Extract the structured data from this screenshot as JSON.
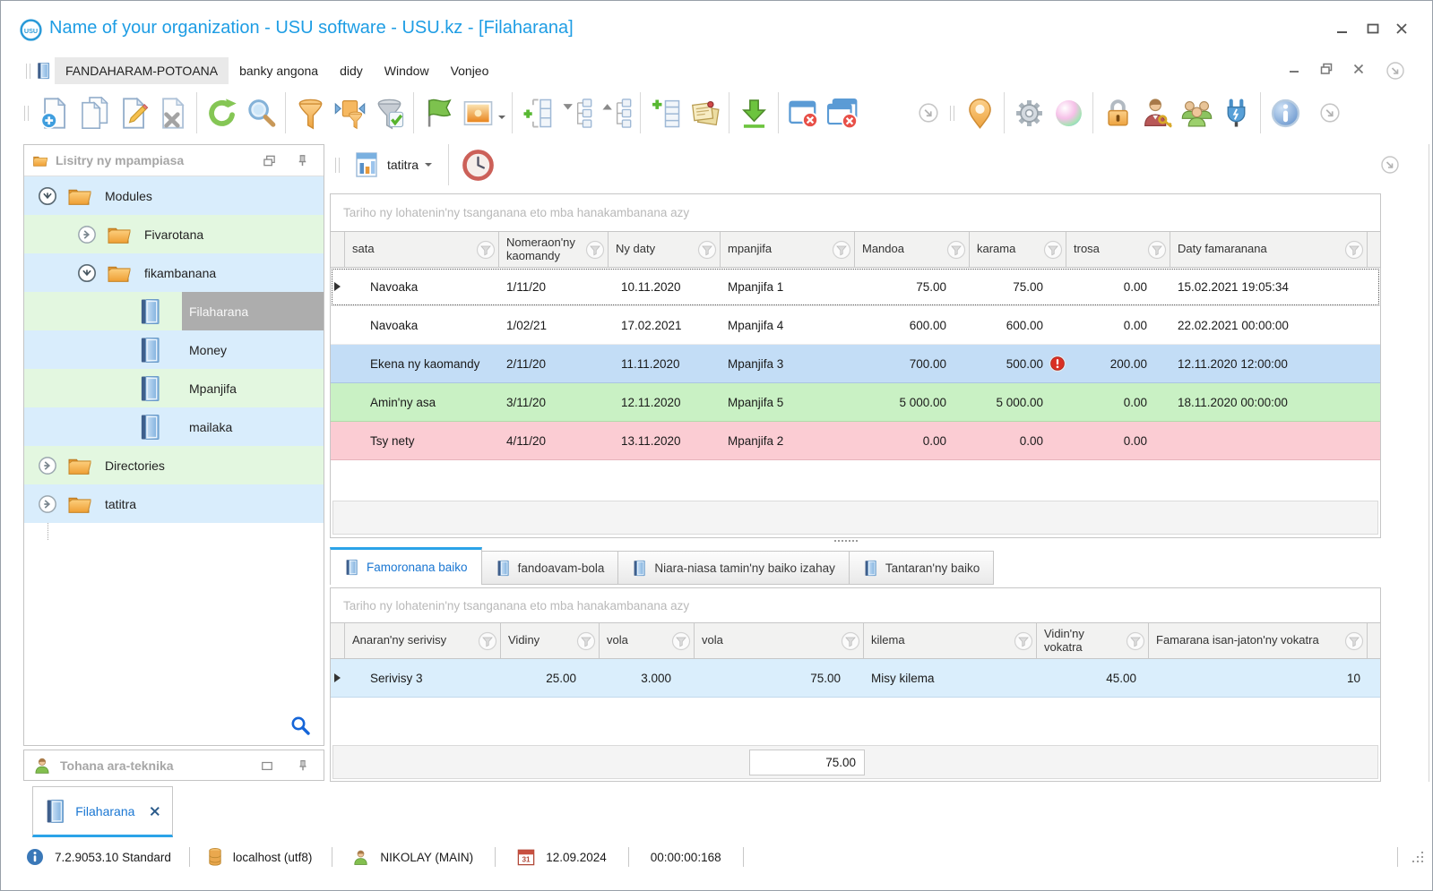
{
  "window": {
    "title": "Name of your organization - USU software - USU.kz - [Filaharana]",
    "logo": "USU"
  },
  "menu": {
    "items": [
      "FANDAHARAM-POTOANA",
      "banky angona",
      "didy",
      "Window",
      "Vonjeo"
    ]
  },
  "toolbar": {
    "icons": [
      "new-document",
      "copy-document",
      "edit-document",
      "delete-document",
      "refresh",
      "search",
      "filter-funnel",
      "filter-values",
      "filter-apply",
      "flag",
      "picture-dropdown",
      "add-column",
      "expand-tree",
      "collapse-tree",
      "add-row",
      "notes",
      "export-download",
      "close-window",
      "close-all-windows",
      "overflow-chevron",
      "map-pin",
      "settings-gear",
      "color-palette",
      "lock",
      "user-key",
      "user-groups",
      "plugin",
      "info"
    ]
  },
  "report_bar": {
    "report_button": "tatitra"
  },
  "sidebar": {
    "title": "Lisitry ny mpampiasa",
    "bottom_panel_title": "Tohana ara-teknika",
    "items": [
      {
        "label": "Modules"
      },
      {
        "label": "Fivarotana"
      },
      {
        "label": "fikambanana"
      },
      {
        "label": "Filaharana"
      },
      {
        "label": "Money"
      },
      {
        "label": "Mpanjifa"
      },
      {
        "label": "mailaka"
      },
      {
        "label": "Directories"
      },
      {
        "label": "tatitra"
      }
    ]
  },
  "orders_grid": {
    "group_hint": "Tariho ny lohatenin'ny tsanganana eto mba hanakambanana azy",
    "columns": [
      "sata",
      "Nomeraon'ny kaomandy",
      "Ny daty",
      "mpanjifa",
      "Mandoa",
      "karama",
      "trosa",
      "Daty famaranana"
    ],
    "rows": [
      [
        "Navoaka",
        "1/11/20",
        "10.11.2020",
        "Mpanjifa 1",
        "75.00",
        "75.00",
        "0.00",
        "15.02.2021 19:05:34"
      ],
      [
        "Navoaka",
        "1/02/21",
        "17.02.2021",
        "Mpanjifa 4",
        "600.00",
        "600.00",
        "0.00",
        "22.02.2021 00:00:00"
      ],
      [
        "Ekena ny kaomandy",
        "2/11/20",
        "11.11.2020",
        "Mpanjifa 3",
        "700.00",
        "500.00",
        "200.00",
        "12.11.2020 12:00:00"
      ],
      [
        "Amin'ny asa",
        "3/11/20",
        "12.11.2020",
        "Mpanjifa 5",
        "5 000.00",
        "5 000.00",
        "0.00",
        "18.11.2020 00:00:00"
      ],
      [
        "Tsy nety",
        "4/11/20",
        "13.11.2020",
        "Mpanjifa 2",
        "0.00",
        "0.00",
        "0.00",
        ""
      ]
    ]
  },
  "detail_tabs": {
    "tabs": [
      {
        "label": "Famoronana baiko"
      },
      {
        "label": "fandoavam-bola"
      },
      {
        "label": "Niara-niasa tamin'ny baiko izahay"
      },
      {
        "label": "Tantaran'ny baiko"
      }
    ]
  },
  "services_grid": {
    "group_hint": "Tariho ny lohatenin'ny tsanganana eto mba hanakambanana azy",
    "columns": [
      "Anaran'ny serivisy",
      "Vidiny",
      "vola",
      "vola",
      "kilema",
      "Vidin'ny vokatra",
      "Famarana isan-jaton'ny vokatra"
    ],
    "rows": [
      [
        "Serivisy 3",
        "25.00",
        "3.000",
        "75.00",
        "Misy kilema",
        "45.00",
        "10"
      ]
    ],
    "footer_total": "75.00"
  },
  "doc_tab": {
    "label": "Filaharana"
  },
  "statusbar": {
    "version": "7.2.9053.10 Standard",
    "database": "localhost (utf8)",
    "user": "NIKOLAY (MAIN)",
    "calendar_day": "31",
    "date": "12.09.2024",
    "timer": "00:00:00:168"
  },
  "colors": {
    "title_blue": "#1e9de4",
    "accent_blue": "#2ba3e8",
    "tree_row_blue": "#d9edfc",
    "tree_row_green": "#e3f7e0",
    "selected_node_gray": "#adadad",
    "order_row_blue": "#c3ddf6",
    "order_row_green": "#c9f1c4",
    "order_row_pink": "#fbccd3",
    "service_row_blue": "#daeefc",
    "warning_red": "#d93025"
  }
}
